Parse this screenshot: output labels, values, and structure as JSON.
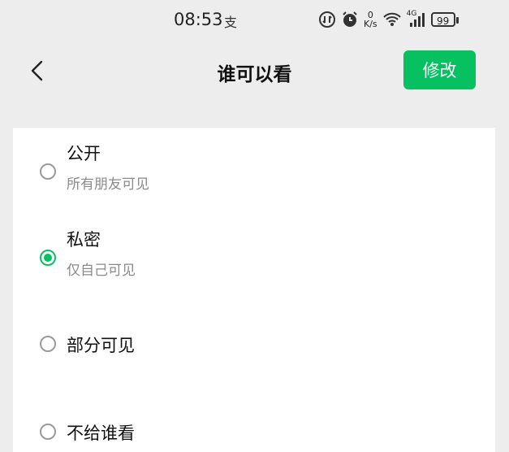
{
  "status_bar": {
    "time": "08:53",
    "alipay_glyph": "支",
    "icons": [
      "data-saver-icon",
      "alarm-icon",
      "wifi-icon",
      "signal-icon"
    ],
    "net_speed_value": "0",
    "net_speed_unit": "K/s",
    "network_type": "4G",
    "battery": "99"
  },
  "nav": {
    "back_icon": "chevron-left-icon",
    "title": "谁可以看",
    "edit_label": "修改",
    "edit_color": "#07c160"
  },
  "options": [
    {
      "title": "公开",
      "subtitle": "所有朋友可见",
      "selected": false
    },
    {
      "title": "私密",
      "subtitle": "仅自己可见",
      "selected": true
    },
    {
      "title": "部分可见",
      "selected": false
    },
    {
      "title": "不给谁看",
      "selected": false
    }
  ]
}
